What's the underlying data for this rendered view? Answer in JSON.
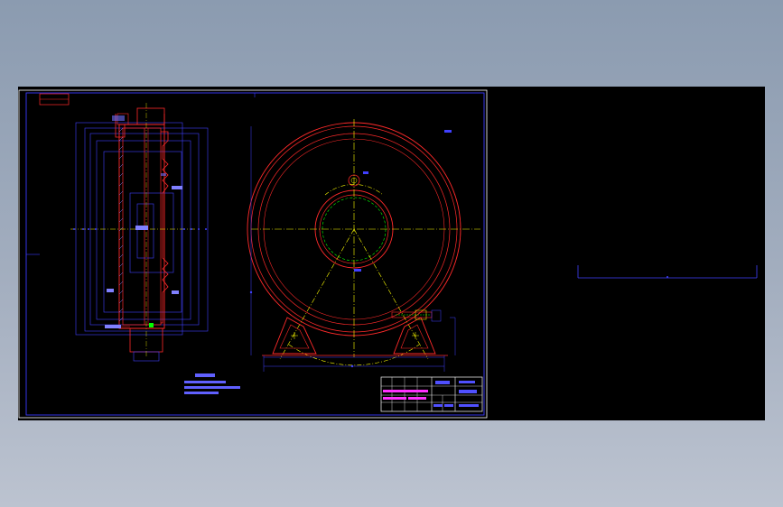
{
  "colors": {
    "background": "#000000",
    "frame": "#3a3aff",
    "outline": "#ff2a2a",
    "center_line": "#ffff00",
    "dimension": "#4040ff",
    "highlight": "#00ff00",
    "table_text": "#ff30ff"
  },
  "drawing": {
    "views": [
      "section-view",
      "front-view"
    ],
    "title_block_present": true,
    "notes_present": true
  }
}
